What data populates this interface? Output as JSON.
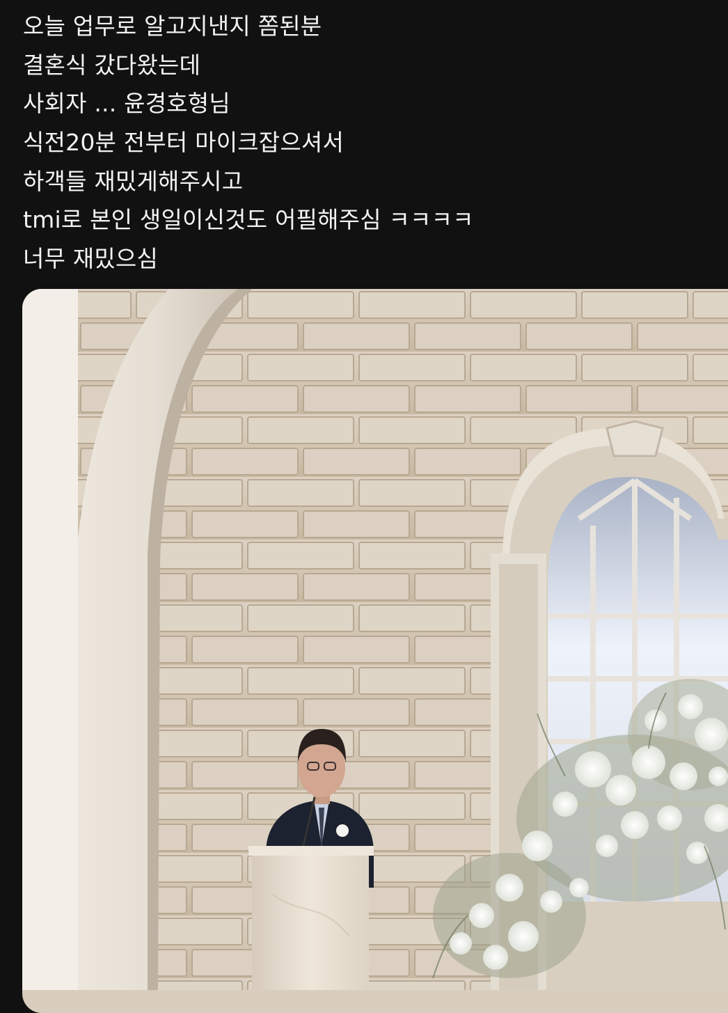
{
  "post": {
    "lines": [
      "오늘 업무로 알고지낸지 쫌된분",
      "결혼식 갔다왔는데",
      "사회자 ... 윤경호형님",
      "식전20분 전부터 마이크잡으셔서",
      "하객들 재밌게해주시고",
      "tmi로 본인 생일이신것도 어필해주심 ㅋㅋㅋㅋ",
      "너무 재밌으심"
    ]
  },
  "colors": {
    "background": "#111111",
    "text": "#f3f3f3",
    "wall": "#d6c9b8",
    "arch": "#ece6dc"
  }
}
